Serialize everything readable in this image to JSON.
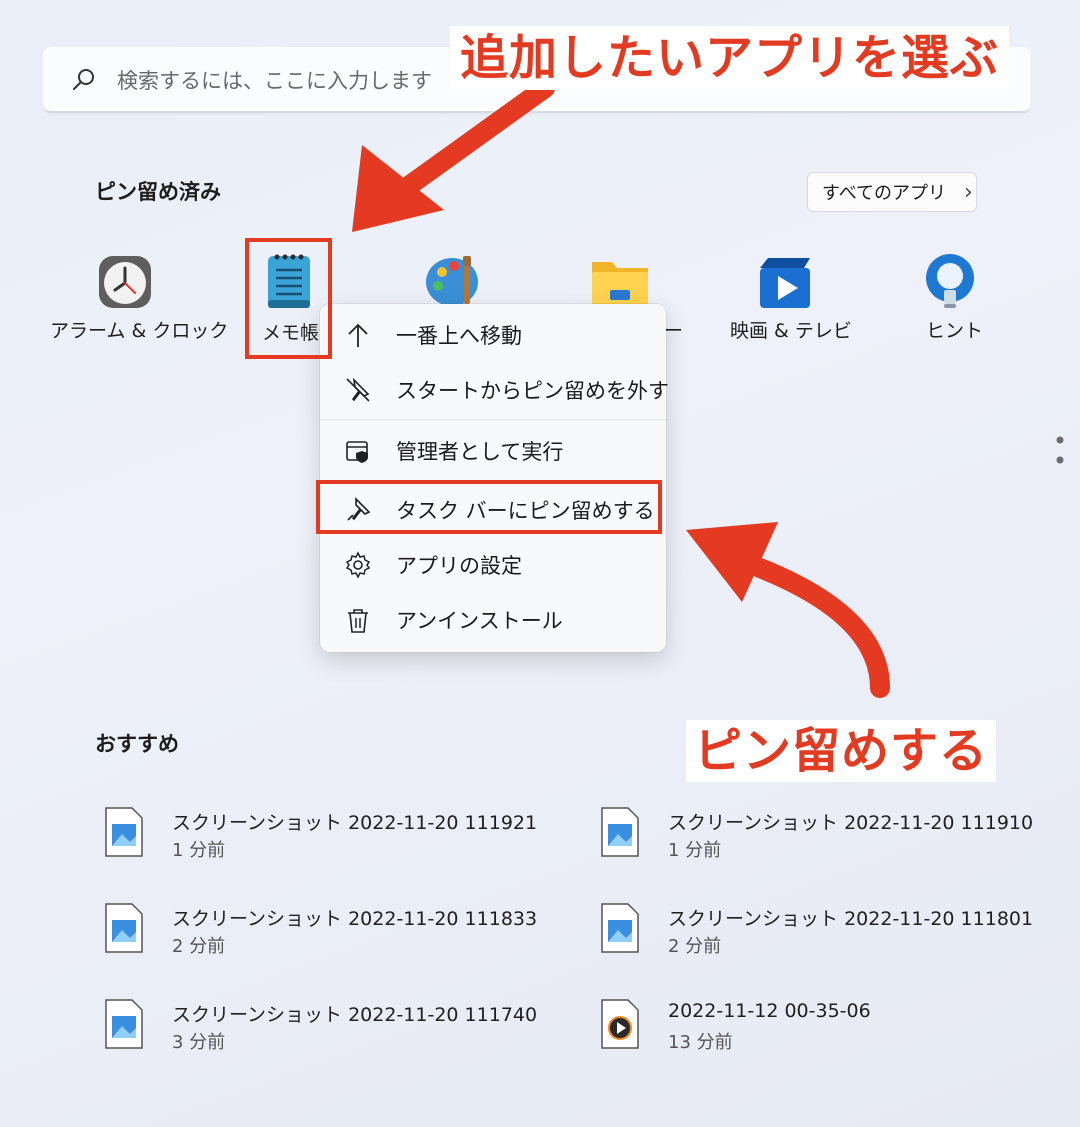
{
  "search": {
    "placeholder": "検索するには、ここに入力します"
  },
  "pinned": {
    "heading": "ピン留め済み",
    "all_apps_label": "すべてのアプリ",
    "all_apps_chevron": "›",
    "apps": [
      {
        "label": "アラーム & クロック",
        "icon": "alarm-clock-icon"
      },
      {
        "label": "メモ帳",
        "icon": "notepad-icon"
      },
      {
        "label": "",
        "icon": "paint-icon"
      },
      {
        "label": "ー",
        "icon": "file-explorer-icon"
      },
      {
        "label": "映画 & テレビ",
        "icon": "movies-tv-icon"
      },
      {
        "label": "ヒント",
        "icon": "tips-lightbulb-icon"
      }
    ]
  },
  "context_menu": {
    "items": [
      {
        "label": "一番上へ移動",
        "icon": "arrow-up-icon"
      },
      {
        "label": "スタートからピン留めを外す",
        "icon": "unpin-icon"
      },
      {
        "label": "管理者として実行",
        "icon": "admin-shield-icon"
      },
      {
        "label": "タスク バーにピン留めする",
        "icon": "pin-icon"
      },
      {
        "label": "アプリの設定",
        "icon": "gear-icon"
      },
      {
        "label": "アンインストール",
        "icon": "trash-icon"
      }
    ]
  },
  "annotations": {
    "top_callout": "追加したいアプリを選ぶ",
    "bottom_callout": "ピン留めする",
    "accent_color": "#e43a21"
  },
  "recommended": {
    "heading": "おすすめ",
    "items": [
      {
        "title": "スクリーンショット 2022-11-20 111921",
        "time": "1 分前",
        "icon": "image-file-icon"
      },
      {
        "title": "スクリーンショット 2022-11-20 111910",
        "time": "1 分前",
        "icon": "image-file-icon"
      },
      {
        "title": "スクリーンショット 2022-11-20 111833",
        "time": "2 分前",
        "icon": "image-file-icon"
      },
      {
        "title": "スクリーンショット 2022-11-20 111801",
        "time": "2 分前",
        "icon": "image-file-icon"
      },
      {
        "title": "スクリーンショット 2022-11-20 111740",
        "time": "3 分前",
        "icon": "image-file-icon"
      },
      {
        "title": "2022-11-12 00-35-06",
        "time": "13 分前",
        "icon": "video-file-icon"
      }
    ]
  }
}
